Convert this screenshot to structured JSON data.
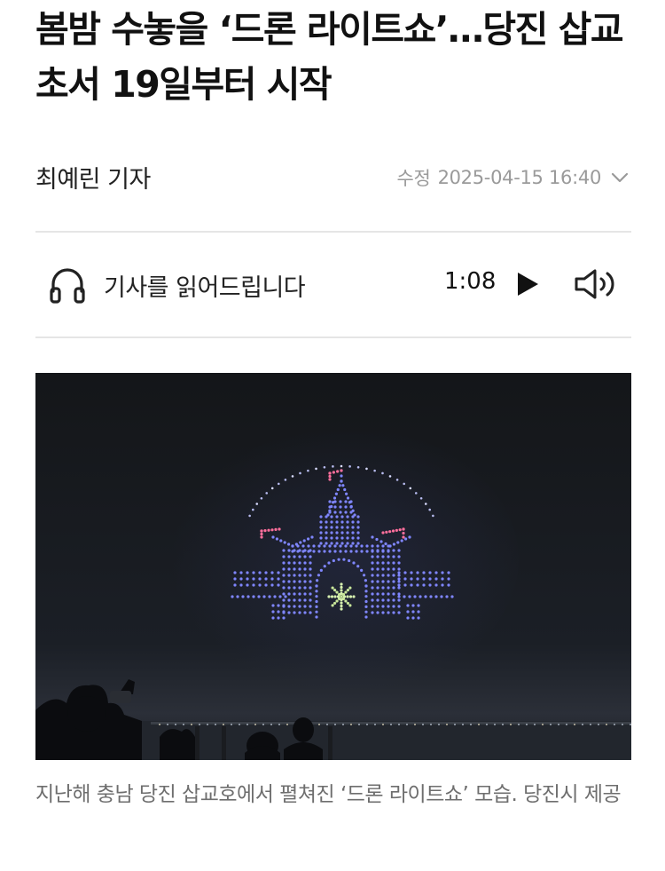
{
  "article": {
    "headline": "봄밤 수놓을 ‘드론 라이트쇼’…당진 삽교초서 19일부터 시작",
    "author": "최예린 기자",
    "modified_label": "수정",
    "modified_datetime": "2025-04-15 16:40"
  },
  "tts": {
    "label": "기사를 읽어드립니다",
    "duration": "1:08",
    "icons": [
      "headphones-icon",
      "play-icon",
      "volume-icon"
    ]
  },
  "photo": {
    "caption": "지난해 충남 당진 삽교호에서 펼쳐진 ‘드론 라이트쇼’ 모습. 당진시 제공"
  },
  "colors": {
    "text": "#111111",
    "meta": "#9a9a9a",
    "caption": "#6e6e6e",
    "divider": "#e5e5e5",
    "drone_blue": "#7f86ff",
    "drone_pink": "#ff6f9c"
  }
}
